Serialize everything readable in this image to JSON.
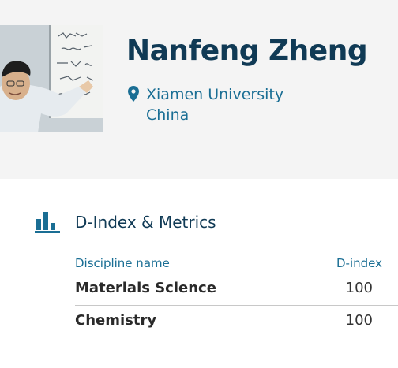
{
  "profile": {
    "name": "Nanfeng Zheng",
    "institution": "Xiamen University",
    "country": "China",
    "photo_icon": "profile-photo",
    "pin_icon": "map-pin-icon"
  },
  "metrics_section": {
    "title": "D-Index & Metrics",
    "icon": "bar-chart-icon",
    "columns": {
      "discipline": "Discipline name",
      "dindex": "D-index"
    },
    "rows": [
      {
        "discipline": "Materials Science",
        "dindex": "100"
      },
      {
        "discipline": "Chemistry",
        "dindex": "100"
      }
    ]
  },
  "colors": {
    "header_bg": "#f4f4f4",
    "name": "#103a55",
    "accent": "#1a6e94",
    "icon": "#1a6e94"
  }
}
